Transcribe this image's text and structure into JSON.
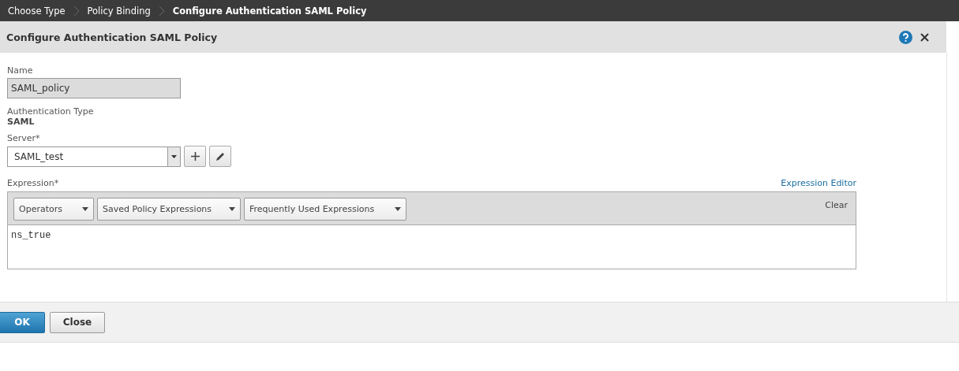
{
  "breadcrumb": [
    {
      "label": "Choose Type",
      "selected": false
    },
    {
      "label": "Policy Binding",
      "selected": false
    },
    {
      "label": "Configure Authentication SAML Policy",
      "selected": true
    }
  ],
  "dialog": {
    "title": "Configure Authentication SAML Policy"
  },
  "name_field": {
    "label": "Name",
    "value": "SAML_policy",
    "disabled": true
  },
  "auth_type": {
    "label": "Authentication Type",
    "value": "SAML"
  },
  "server": {
    "label": "Server*",
    "value": "SAML_test"
  },
  "expression": {
    "label": "Expression*",
    "editor_link": "Expression Editor",
    "dropdowns": [
      "Operators",
      "Saved Policy Expressions",
      "Frequently Used Expressions"
    ],
    "clear": "Clear",
    "value": "ns_true"
  },
  "buttons": [
    {
      "label": "OK",
      "kind": "primary"
    },
    {
      "label": "Close",
      "kind": "secondary"
    }
  ]
}
